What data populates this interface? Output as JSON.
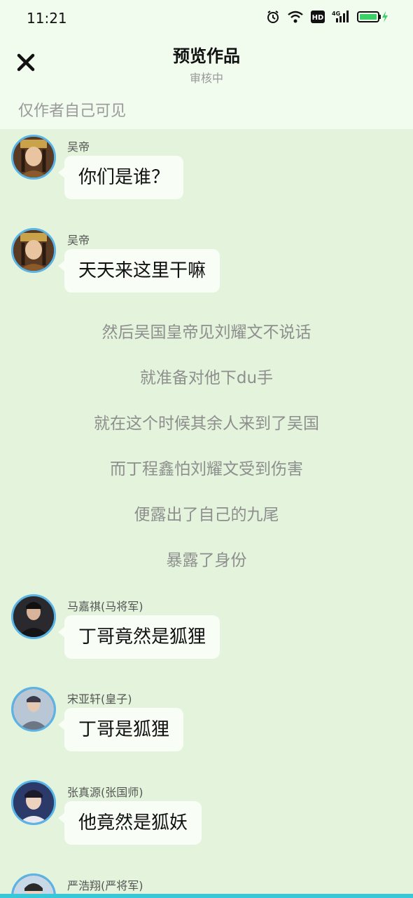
{
  "status_bar": {
    "time": "11:21",
    "network_badge": "4G",
    "hd_badge": "HD"
  },
  "header": {
    "title": "预览作品",
    "subtitle": "审核中",
    "visibility_note": "仅作者自己可见"
  },
  "messages": [
    {
      "speaker": "吴帝",
      "text": "你们是谁？"
    },
    {
      "speaker": "吴帝",
      "text": "天天来这里干嘛"
    }
  ],
  "narration": [
    "然后吴国皇帝见刘耀文不说话",
    "就准备对他下du手",
    "就在这个时候其余人来到了吴国",
    "而丁程鑫怕刘耀文受到伤害",
    "便露出了自己的九尾",
    "暴露了身份"
  ],
  "messages_after": [
    {
      "speaker": "马嘉祺(马将军)",
      "text": "丁哥竟然是狐狸"
    },
    {
      "speaker": "宋亚轩(皇子)",
      "text": "丁哥是狐狸"
    },
    {
      "speaker": "张真源(张国师)",
      "text": "他竟然是狐妖"
    },
    {
      "speaker": "严浩翔(严将军)",
      "text": ""
    }
  ],
  "colors": {
    "background": "#e4f4dc",
    "header": "#f1fbee",
    "avatar_ring": "#5ab4e6",
    "bubble": "#f8fdf6"
  }
}
